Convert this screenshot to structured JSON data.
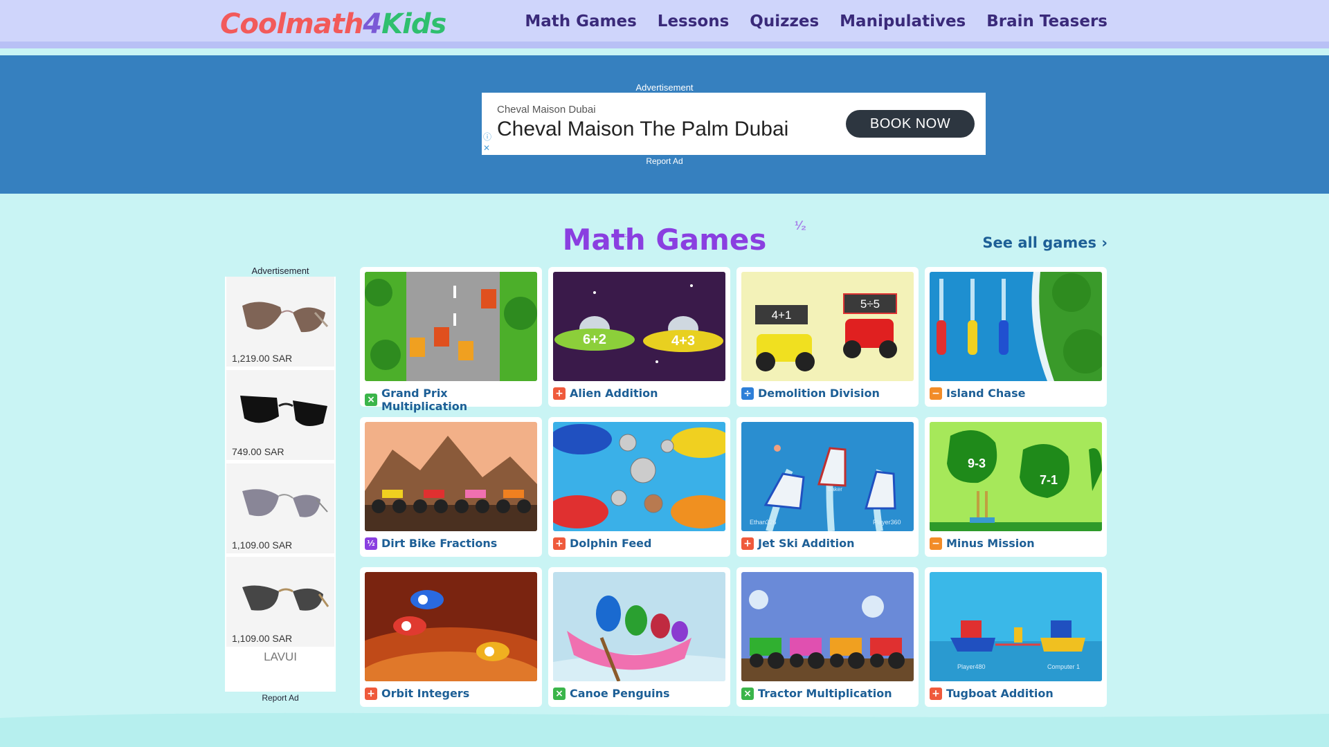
{
  "header": {
    "logo": {
      "part1": "Coolmath",
      "part2": "4",
      "part3": "Kids"
    },
    "nav": [
      "Math Games",
      "Lessons",
      "Quizzes",
      "Manipulatives",
      "Brain Teasers"
    ]
  },
  "top_ad": {
    "label": "Advertisement",
    "advertiser": "Cheval Maison Dubai",
    "headline": "Cheval Maison The Palm Dubai",
    "cta": "BOOK NOW",
    "report": "Report Ad"
  },
  "section": {
    "title": "Math Games",
    "see_all": "See all games ›"
  },
  "side_ad": {
    "label": "Advertisement",
    "prices": [
      "1,219.00 SAR",
      "749.00 SAR",
      "1,109.00 SAR",
      "1,109.00 SAR"
    ],
    "brand": "LAVUI",
    "report": "Report Ad"
  },
  "games": [
    {
      "title": "Grand Prix Multiplication",
      "op": "×",
      "op_color": "#3bb54a"
    },
    {
      "title": "Alien Addition",
      "op": "+",
      "op_color": "#ef5a3c"
    },
    {
      "title": "Demolition Division",
      "op": "÷",
      "op_color": "#2e7fd8"
    },
    {
      "title": "Island Chase",
      "op": "−",
      "op_color": "#f28c28"
    },
    {
      "title": "Dirt Bike Fractions",
      "op": "½",
      "op_color": "#8a3fe0"
    },
    {
      "title": "Dolphin Feed",
      "op": "+",
      "op_color": "#ef5a3c"
    },
    {
      "title": "Jet Ski Addition",
      "op": "+",
      "op_color": "#ef5a3c"
    },
    {
      "title": "Minus Mission",
      "op": "−",
      "op_color": "#f28c28"
    },
    {
      "title": "Orbit Integers",
      "op": "+",
      "op_color": "#ef5a3c"
    },
    {
      "title": "Canoe Penguins",
      "op": "×",
      "op_color": "#3bb54a"
    },
    {
      "title": "Tractor Multiplication",
      "op": "×",
      "op_color": "#3bb54a"
    },
    {
      "title": "Tugboat Addition",
      "op": "+",
      "op_color": "#ef5a3c"
    }
  ],
  "thumb_text": {
    "alien": [
      "6+2",
      "4+3"
    ],
    "demolition": [
      "4+1",
      "5÷5"
    ],
    "minus": [
      "9-3",
      "7-1"
    ],
    "jetski": [
      "Ethan326",
      "Baker",
      "Player360"
    ],
    "tugboat": [
      "Player480",
      "Computer 1"
    ]
  }
}
